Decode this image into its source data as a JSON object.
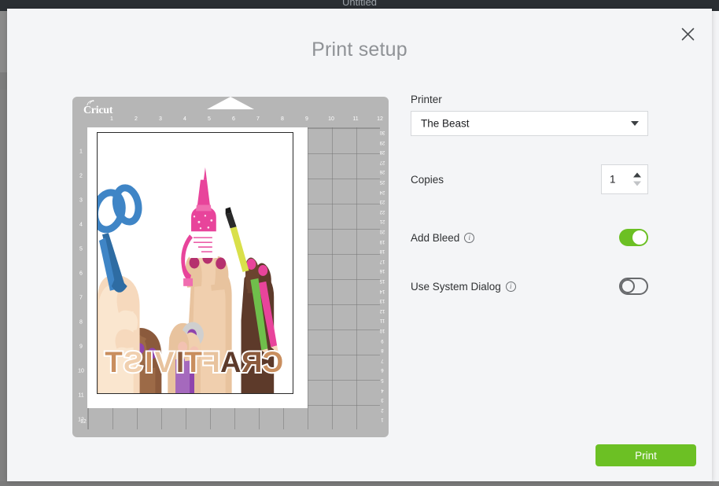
{
  "background": {
    "app_title": "Untitled"
  },
  "modal": {
    "title": "Print setup",
    "close_icon": "close-icon"
  },
  "preview": {
    "brand": "Cricut",
    "ruler_top": [
      "1",
      "2",
      "3",
      "4",
      "5",
      "6",
      "7",
      "8",
      "9",
      "10",
      "11",
      "12"
    ],
    "ruler_left": [
      "1",
      "2",
      "3",
      "4",
      "5",
      "6",
      "7",
      "8",
      "9",
      "10",
      "11",
      "12"
    ],
    "ruler_bottom": [
      "30",
      "29",
      "28",
      "27",
      "26",
      "25",
      "24",
      "23",
      "22",
      "21",
      "20",
      "19",
      "18",
      "17",
      "16",
      "15",
      "14",
      "13",
      "12",
      "11",
      "10",
      "9",
      "8",
      "7",
      "6",
      "5",
      "4",
      "3",
      "2",
      "1"
    ],
    "ruler_right": [
      "30",
      "29",
      "28",
      "27",
      "26",
      "25",
      "24",
      "23",
      "22",
      "21",
      "20",
      "19",
      "18",
      "17",
      "16",
      "15",
      "14",
      "13",
      "12",
      "11",
      "10",
      "9",
      "8",
      "7",
      "6",
      "5",
      "4",
      "3",
      "2",
      "1"
    ],
    "corner_label": "12",
    "artwork": {
      "name": "craftivist-poster",
      "headline": "CRAFTIVIST",
      "mirrored": true,
      "colors": {
        "scissors": "#3f85c6",
        "glitter_glue": "#e8449b",
        "brush_handle": "#d9e04a",
        "nail_polish": "#8e44ad",
        "marker": "#f36f21",
        "skin_1": "#f6d9bd",
        "skin_2": "#e8c39e",
        "skin_3": "#c98e5e",
        "skin_4": "#8b5a3c",
        "skin_5": "#5d3a2a"
      }
    }
  },
  "form": {
    "printer": {
      "label": "Printer",
      "value": "The Beast",
      "options": [
        "The Beast"
      ]
    },
    "copies": {
      "label": "Copies",
      "value": "1"
    },
    "add_bleed": {
      "label": "Add Bleed",
      "info": "i",
      "state": "on"
    },
    "use_system_dialog": {
      "label": "Use System Dialog",
      "info": "i",
      "state": "off"
    }
  },
  "footer": {
    "print_label": "Print"
  },
  "colors": {
    "accent_green": "#6cc024",
    "mat_gray": "#b6b6b6",
    "modal_bg": "#f4f5f7",
    "title_gray": "#8f9296"
  }
}
